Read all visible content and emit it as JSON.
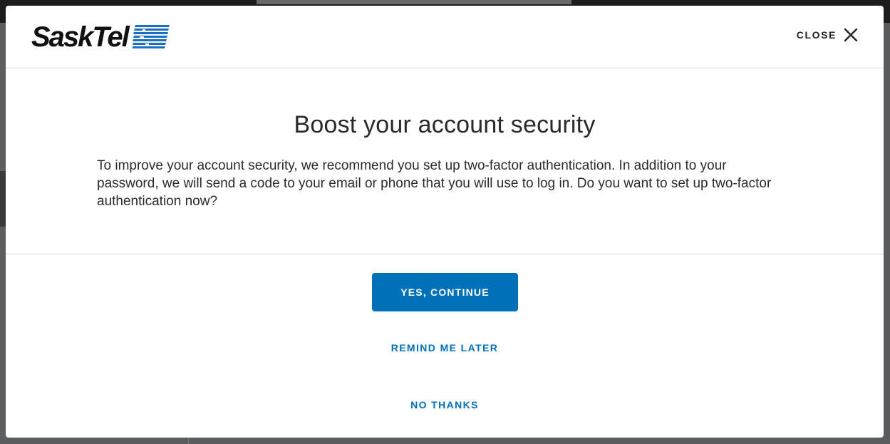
{
  "brand": {
    "name": "SaskTel",
    "logo_icon": "sasktel-stripes-logo",
    "accent_color": "#0070b8"
  },
  "modal": {
    "close_label": "CLOSE",
    "title": "Boost your account security",
    "message": "To improve your account security, we recommend you set up two-factor authentication. In addition to your password, we will send a code to your email or phone that you will use to log in. Do you want to set up two-factor authentication now?",
    "primary_button": "YES, CONTINUE",
    "remind_link": "REMIND ME LATER",
    "decline_link": "NO THANKS"
  }
}
